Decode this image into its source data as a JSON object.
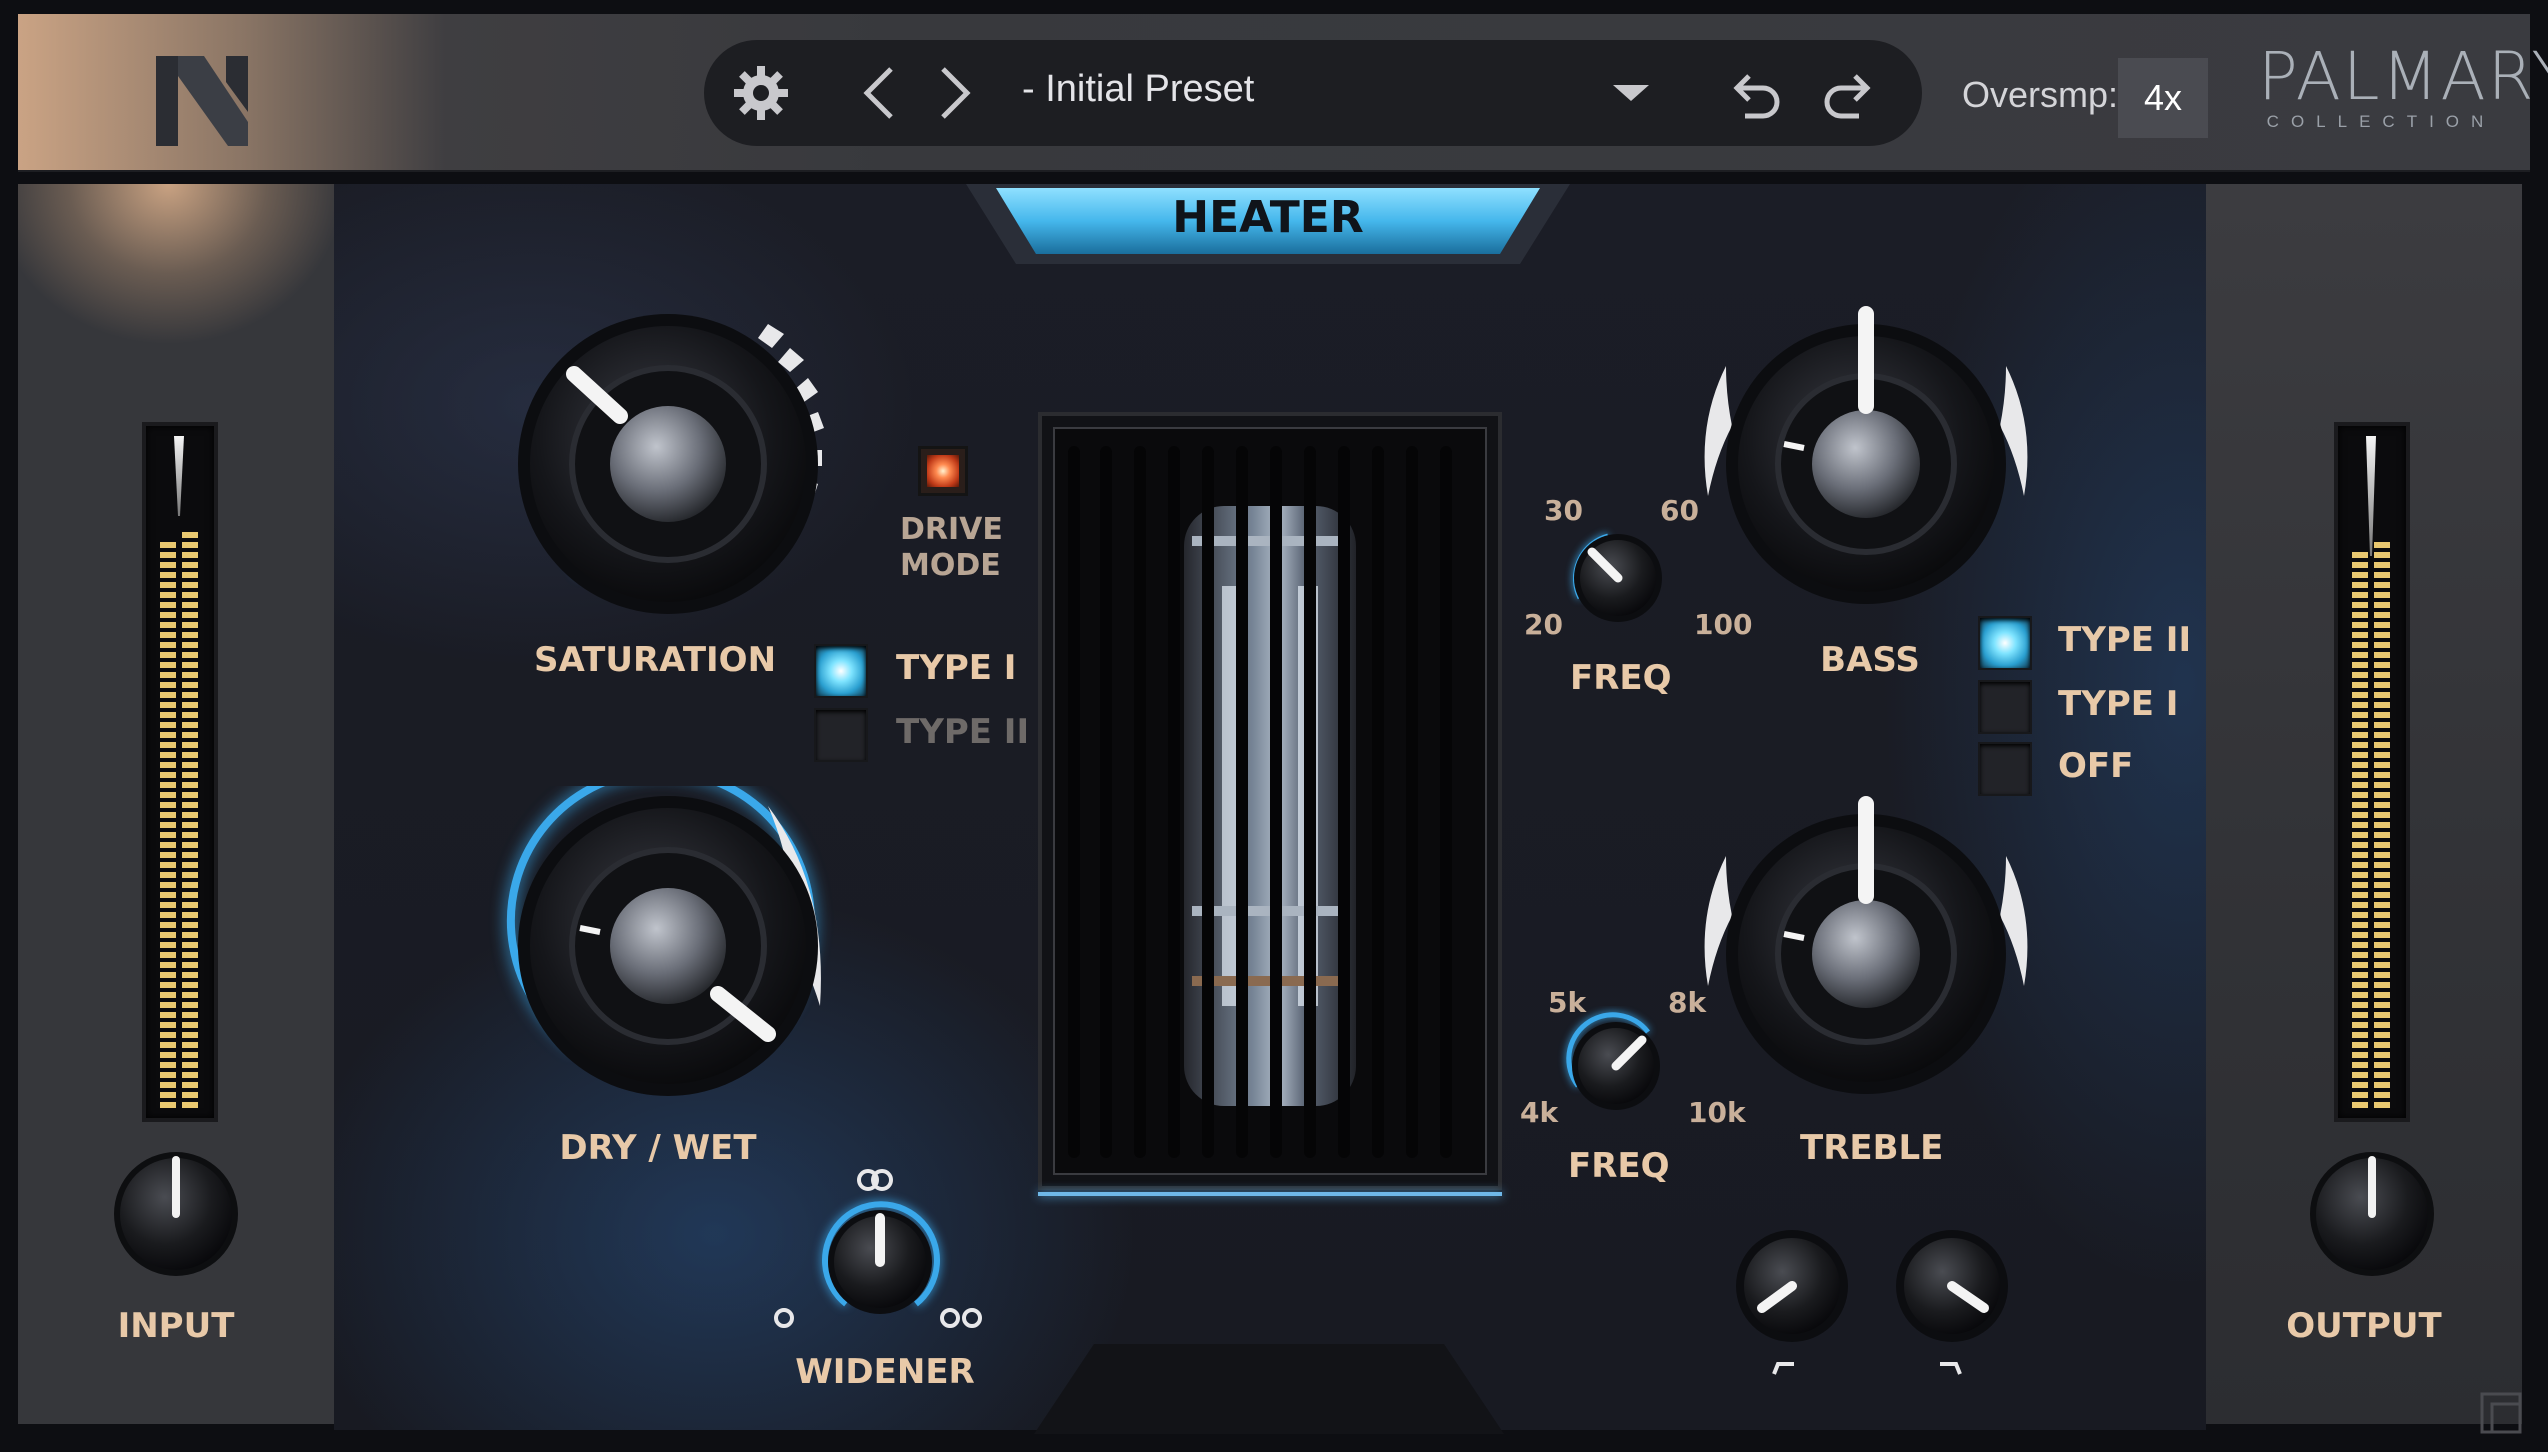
{
  "header": {
    "logo_letter": "N",
    "settings_icon": "gear-icon",
    "prev_icon": "chevron-left-icon",
    "next_icon": "chevron-right-icon",
    "preset_name": "- Initial Preset",
    "dropdown_icon": "caret-down-icon",
    "undo_icon": "undo-icon",
    "redo_icon": "redo-icon",
    "oversampling_label": "Oversmp:",
    "oversampling_value": "4x",
    "brand_name": "PALMARY",
    "brand_sub": "COLLECTION"
  },
  "title": "HEATER",
  "input": {
    "label": "INPUT"
  },
  "output": {
    "label": "OUTPUT"
  },
  "saturation": {
    "label": "SATURATION"
  },
  "drive_mode": {
    "line1": "DRIVE",
    "line2": "MODE"
  },
  "drive_types": [
    {
      "label": "TYPE I",
      "active": true
    },
    {
      "label": "TYPE II",
      "active": false
    }
  ],
  "dry_wet": {
    "label": "DRY / WET"
  },
  "widener": {
    "label": "WIDENER"
  },
  "bass_freq": {
    "label": "FREQ",
    "scale": [
      "30",
      "60",
      "20",
      "100"
    ]
  },
  "bass": {
    "label": "BASS"
  },
  "bass_types": [
    {
      "label": "TYPE II",
      "active": true
    },
    {
      "label": "TYPE I",
      "active": false
    },
    {
      "label": "OFF",
      "active": false
    }
  ],
  "treble_freq": {
    "label": "FREQ",
    "scale": [
      "5k",
      "8k",
      "4k",
      "10k"
    ]
  },
  "treble": {
    "label": "TREBLE"
  },
  "colors": {
    "accent": "#2ea8e6",
    "label": "#e8c9a8",
    "title_bg": "#55c6f2"
  }
}
